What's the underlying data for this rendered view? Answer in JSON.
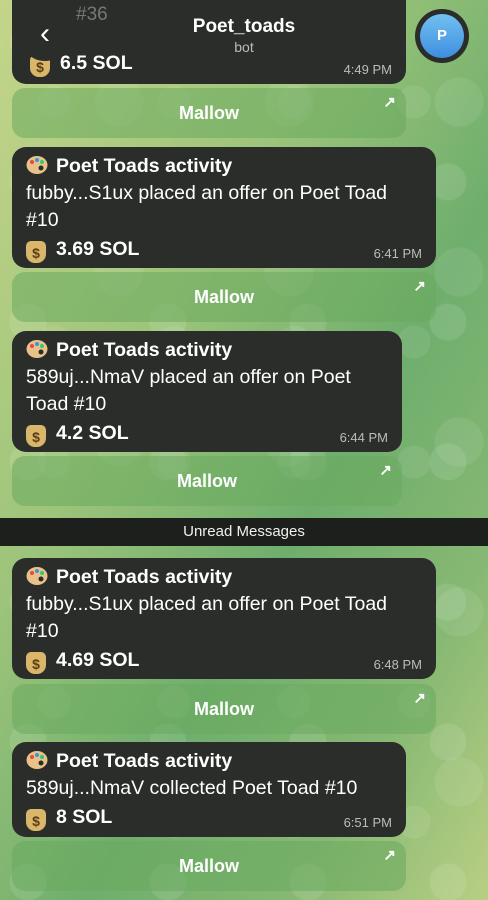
{
  "header": {
    "title": "Poet_toads",
    "subtitle": "bot",
    "avatar_letter": "P",
    "back_icon": "chevron-left-icon"
  },
  "partial_message": {
    "faded_text": "#36",
    "amount": "6.5 SOL",
    "time": "4:49 PM"
  },
  "messages": [
    {
      "title": "Poet Toads activity",
      "text": "fubby...S1ux placed an offer on Poet Toad #10",
      "amount": "3.69 SOL",
      "time": "6:41 PM"
    },
    {
      "title": "Poet Toads activity",
      "text": "589uj...NmaV placed an offer on Poet Toad #10",
      "amount": "4.2 SOL",
      "time": "6:44 PM"
    },
    {
      "title": "Poet Toads activity",
      "text": "fubby...S1ux placed an offer on Poet Toad #10",
      "amount": "4.69 SOL",
      "time": "6:48 PM"
    },
    {
      "title": "Poet Toads activity",
      "text": "589uj...NmaV collected Poet Toad #10",
      "amount": "8 SOL",
      "time": "6:51 PM"
    }
  ],
  "button_label": "Mallow",
  "unread_label": "Unread Messages",
  "colors": {
    "bubble": "#2a2d2a",
    "button": "#69aa5f",
    "avatar": "#3d8fe0"
  }
}
